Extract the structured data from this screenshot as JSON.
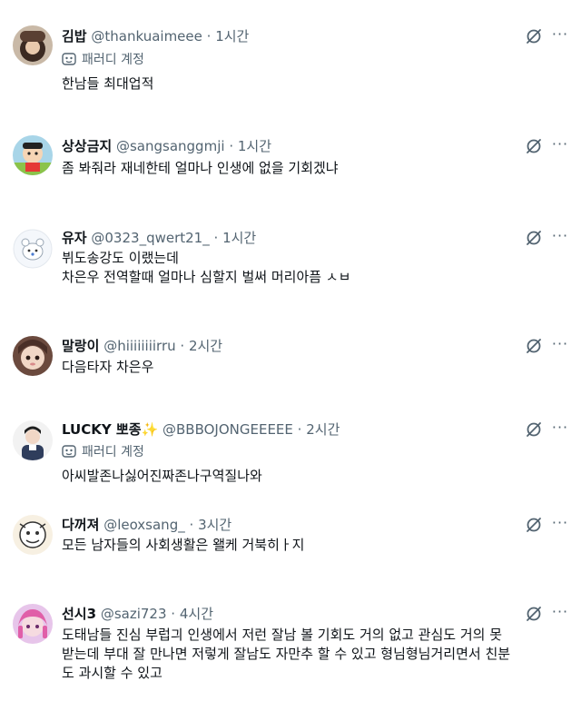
{
  "replies": [
    {
      "name": "김밥",
      "handle": "@thankuaimeee",
      "dot": "·",
      "time": "1시간",
      "parody_label": "패러디 계정",
      "lines": [
        "한남들 최대업적"
      ]
    },
    {
      "name": "상상금지",
      "handle": "@sangsanggmji",
      "dot": "·",
      "time": "1시간",
      "lines": [
        "좀 봐줘라 재네한테 얼마나 인생에 없을 기회겠냐"
      ]
    },
    {
      "name": "유자",
      "handle": "@0323_qwert21_",
      "dot": "·",
      "time": "1시간",
      "lines": [
        "뷔도송강도 이랬는데",
        "차은우 전역할때 얼마나 심할지 벌써 머리아픔 ㅅㅂ"
      ]
    },
    {
      "name": "말랑이",
      "handle": "@hiiiiiiiirru",
      "dot": "·",
      "time": "2시간",
      "lines": [
        "다음타자 차은우"
      ]
    },
    {
      "name": "LUCKY 뽀종",
      "sparkle": "✨",
      "handle": "@BBBOJONGEEEEE",
      "dot": "·",
      "time": "2시간",
      "parody_label": "패러디 계정",
      "lines": [
        "아씨발존나싫어진짜존나구역질나와"
      ]
    },
    {
      "name": "다꺼져",
      "handle": "@leoxsang_",
      "dot": "·",
      "time": "3시간",
      "lines": [
        "모든 남자들의 사회생활은 왤케 거북히ㅏ지"
      ]
    },
    {
      "name": "선시3",
      "handle": "@sazi723",
      "dot": "·",
      "time": "4시간",
      "lines": [
        "도태남들 진심 부럽긔 인생에서 저런 잘남 볼 기회도 거의 없고 관심도 거의 못",
        "받는데 부대 잘 만나면 저렇게 잘남도 자만추 할 수 있고 형님형님거리면서 친분",
        "도 과시할 수 있고"
      ]
    }
  ],
  "more_glyph": "···",
  "icons": {
    "grok": "grok-icon",
    "more": "more-icon",
    "parody": "parody-mask-icon"
  },
  "colors": {
    "text": "#0f1419",
    "secondary": "#536471",
    "background": "#ffffff"
  }
}
